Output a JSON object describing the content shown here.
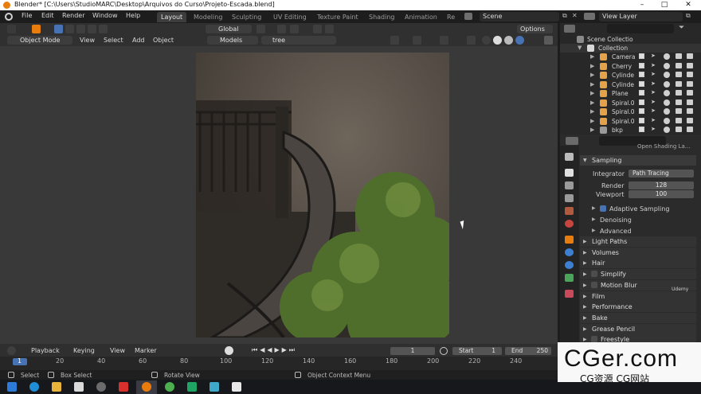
{
  "window": {
    "title": "Blender* [C:\\Users\\StudioMARC\\Desktop\\Arquivos do Curso\\Projeto-Escada.blend]"
  },
  "menubar": {
    "items": [
      "File",
      "Edit",
      "Render",
      "Window",
      "Help"
    ],
    "workspaces": [
      "Layout",
      "Modeling",
      "Sculpting",
      "UV Editing",
      "Texture Paint",
      "Shading",
      "Animation",
      "Re"
    ],
    "active_workspace": "Layout",
    "scene": "Scene",
    "view_layer": "View Layer"
  },
  "viewport_header": {
    "orientation": "Global",
    "options": "Options",
    "mode": "Object Mode",
    "menus": [
      "View",
      "Select",
      "Add",
      "Object"
    ],
    "collection": "Models",
    "search_value": "tree"
  },
  "timeline": {
    "menus": [
      "Playback",
      "Keying",
      "View",
      "Marker"
    ],
    "current_frame": "1",
    "start_label": "Start",
    "start": "1",
    "end_label": "End",
    "end": "250",
    "ruler_ticks": [
      "1",
      "20",
      "40",
      "60",
      "80",
      "100",
      "120",
      "140",
      "160",
      "180",
      "200",
      "220",
      "240"
    ]
  },
  "statusbar": {
    "hints": [
      "Select",
      "Box Select",
      "Rotate View",
      "Object Context Menu"
    ]
  },
  "outliner": {
    "root": "Scene Collectio",
    "collection": "Collection",
    "items": [
      {
        "label": "Camera",
        "icon": "camera-icon",
        "color": "#e4a34a"
      },
      {
        "label": "Cherry",
        "icon": "object-icon",
        "color": "#e4a34a"
      },
      {
        "label": "Cylinde",
        "icon": "mesh-icon",
        "color": "#e4a34a"
      },
      {
        "label": "Cylinde",
        "icon": "mesh-icon",
        "color": "#e4a34a"
      },
      {
        "label": "Plane",
        "icon": "mesh-icon",
        "color": "#e4a34a"
      },
      {
        "label": "Spiral.0",
        "icon": "mesh-icon",
        "color": "#e4a34a"
      },
      {
        "label": "Spiral.0",
        "icon": "mesh-icon",
        "color": "#e4a34a"
      },
      {
        "label": "Spiral.0",
        "icon": "mesh-icon",
        "color": "#e4a34a"
      },
      {
        "label": "bkp",
        "icon": "collection-icon",
        "color": "#9a9a9a"
      }
    ]
  },
  "properties": {
    "top_label": "Open Shading La...",
    "sampling": {
      "title": "Sampling",
      "integrator_label": "Integrator",
      "integrator": "Path Tracing",
      "render_label": "Render",
      "render": "128",
      "viewport_label": "Viewport",
      "viewport": "100",
      "adaptive": "Adaptive Sampling",
      "denoising": "Denoising",
      "advanced": "Advanced"
    },
    "panels": [
      "Light Paths",
      "Volumes",
      "Hair",
      "Simplify",
      "Motion Blur",
      "Film",
      "Performance",
      "Bake",
      "Grease Pencil",
      "Freestyle"
    ],
    "checkbox_panels": [
      "Simplify",
      "Motion Blur",
      "Freestyle"
    ],
    "udemy": "Udemy"
  },
  "watermark": {
    "title": "CGer.com",
    "subtitle": "CG资源 CG网站"
  },
  "colors": {
    "accent": "#4772b3",
    "active_orange": "#e87d0d"
  }
}
